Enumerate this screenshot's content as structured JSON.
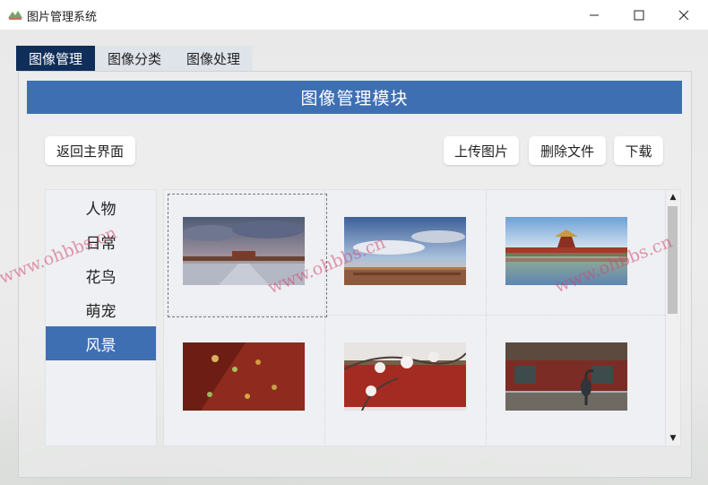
{
  "window": {
    "title": "图片管理系统",
    "minimize": "—",
    "maximize": "☐",
    "close": "✕"
  },
  "tabs": [
    {
      "label": "图像管理",
      "active": true
    },
    {
      "label": "图像分类",
      "active": false
    },
    {
      "label": "图像处理",
      "active": false
    }
  ],
  "module": {
    "title": "图像管理模块"
  },
  "buttons": {
    "back": "返回主界面",
    "upload": "上传图片",
    "delete": "删除文件",
    "download": "下载"
  },
  "categories": [
    {
      "label": "人物",
      "selected": false
    },
    {
      "label": "日常",
      "selected": false
    },
    {
      "label": "花鸟",
      "selected": false
    },
    {
      "label": "萌宠",
      "selected": false
    },
    {
      "label": "风景",
      "selected": true
    }
  ],
  "gallery": {
    "images": [
      {
        "desc": "palace-square-clouds",
        "selected": true
      },
      {
        "desc": "palace-skyline-sunset",
        "selected": false
      },
      {
        "desc": "corner-tower-reflection",
        "selected": false
      },
      {
        "desc": "red-wall-autumn",
        "selected": false
      },
      {
        "desc": "snow-branches-red-wall",
        "selected": false
      },
      {
        "desc": "courtyard-bronze-crane",
        "selected": false
      }
    ]
  },
  "scrollbar": {
    "up": "▲",
    "down": "▼"
  },
  "watermark": "www.ohbbs.cn",
  "colors": {
    "accent": "#3f6fb3",
    "active_tab": "#0f2e59"
  }
}
